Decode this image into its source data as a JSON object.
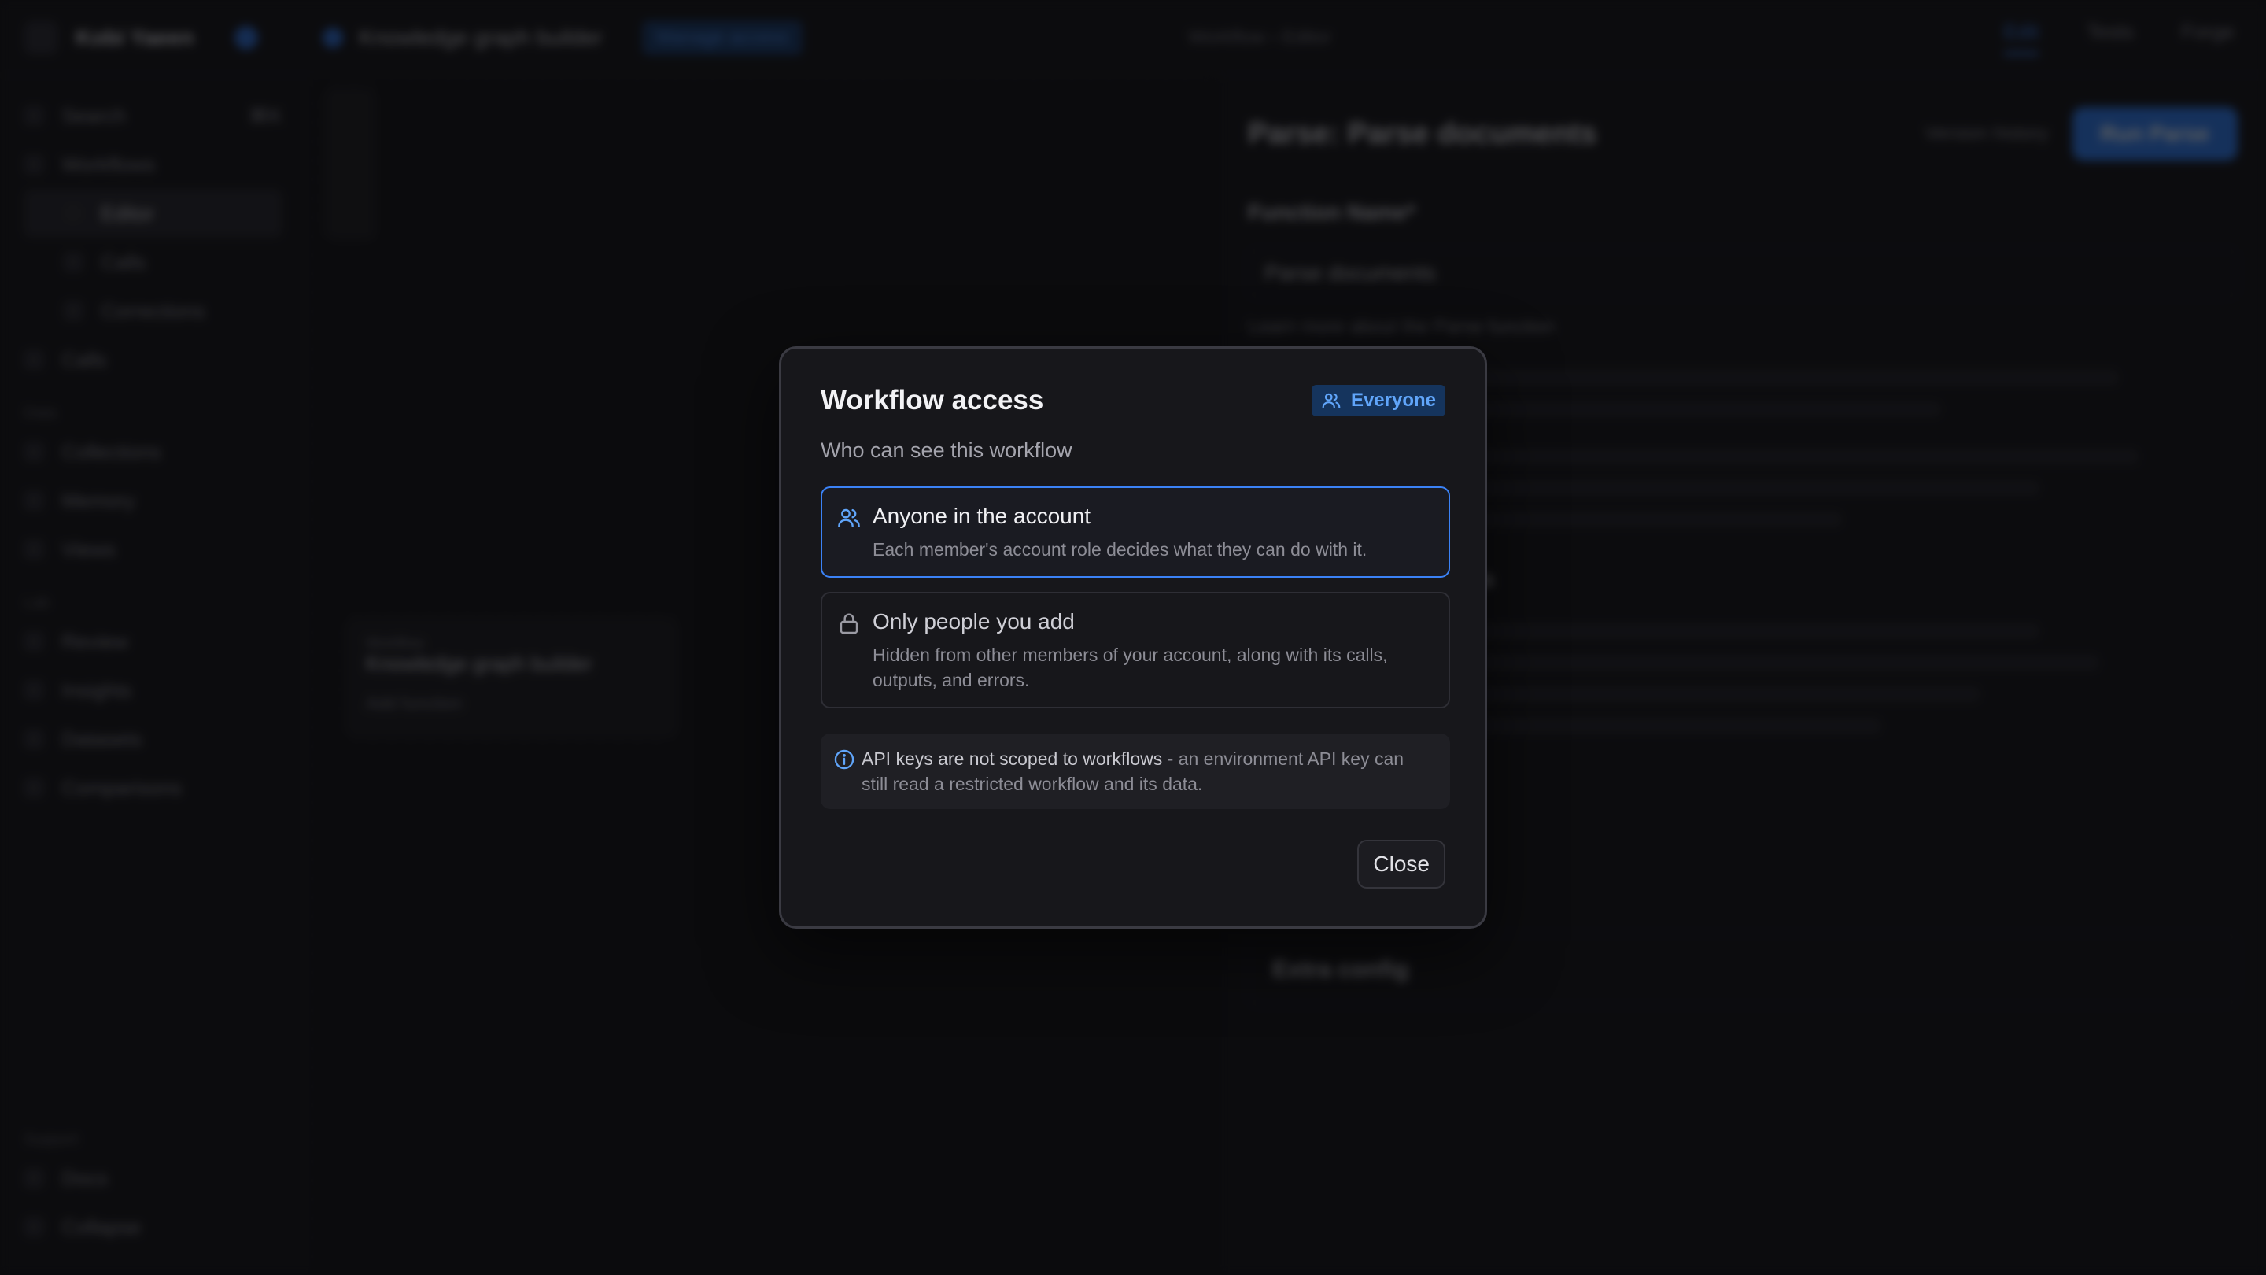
{
  "app": {
    "org_name": "Kobi Yaeen",
    "workflow_name": "Knowledge graph builder",
    "manage_access_label": "Manage access",
    "breadcrumb": "Workflow › Editor",
    "top_tabs": [
      "Edit",
      "Tests",
      "Forge"
    ],
    "sidebar": {
      "search": "Search",
      "search_shortcut": "⌘K",
      "items": [
        {
          "label": "Workflows"
        },
        {
          "label": "Editor",
          "sub": true,
          "selected": true
        },
        {
          "label": "Calls",
          "sub": true
        },
        {
          "label": "Corrections",
          "sub": true
        },
        {
          "label": "Calls"
        }
      ],
      "group_data": "Data",
      "data_items": [
        "Collections",
        "Memory",
        "Views"
      ],
      "group_lab": "Lab",
      "lab_items": [
        "Review",
        "Insights",
        "Datasets",
        "Comparisons"
      ],
      "group_support": "Support",
      "support_items": [
        "Docs",
        "Collapse"
      ]
    },
    "canvas_node": {
      "kind": "Workflow",
      "name": "Knowledge graph builder",
      "add": "Add function"
    },
    "panel": {
      "title": "Parse: Parse documents",
      "version_history": "Version history",
      "run_label": "Run Parse",
      "function_name_label": "Function Name*",
      "function_name_value": "Parse documents",
      "learn_more": "Learn more about the Parse function",
      "section_link": "Link across documents",
      "extra_config": "Extra config"
    }
  },
  "modal": {
    "title": "Workflow access",
    "badge_label": "Everyone",
    "subtitle": "Who can see this workflow",
    "options": [
      {
        "title": "Anyone in the account",
        "description": "Each member's account role decides what they can do with it.",
        "icon": "users-icon",
        "selected": true
      },
      {
        "title": "Only people you add",
        "description": "Hidden from other members of your account, along with its calls, outputs, and errors.",
        "icon": "lock-icon",
        "selected": false
      }
    ],
    "info": {
      "strong": "API keys are not scoped to workflows",
      "rest": " - an environment API key can still read a restricted workflow and its data."
    },
    "close_label": "Close"
  },
  "colors": {
    "accent": "#3b82f6",
    "badge_bg": "#15345d",
    "modal_bg": "#17171b"
  }
}
